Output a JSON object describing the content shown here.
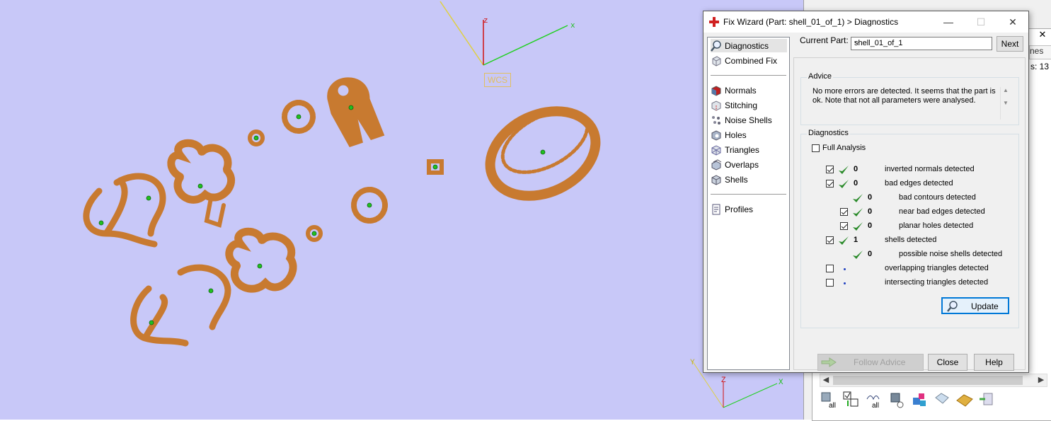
{
  "viewport": {
    "wcs_label": "WCS",
    "axis_labels": {
      "z": "z",
      "x": "x",
      "mini_z": "Z",
      "mini_x": "X",
      "mini_y": "Y"
    },
    "background_color": "#c8c8f8",
    "part_color": "#c87a30"
  },
  "right_panel": {
    "tab_label": "nes",
    "count_text": "s: 13",
    "close_glyph": "✕"
  },
  "dialog": {
    "title": "Fix Wizard (Part: shell_01_of_1) > Diagnostics",
    "window_buttons": {
      "minimize": "—",
      "maximize": "☐",
      "close": "✕"
    },
    "nav": {
      "top_items": [
        {
          "label": "Diagnostics",
          "icon": "magnifier-icon",
          "selected": true
        },
        {
          "label": "Combined Fix",
          "icon": "cube-icon"
        }
      ],
      "fix_items": [
        {
          "label": "Normals",
          "icon": "normals-icon"
        },
        {
          "label": "Stitching",
          "icon": "stitching-icon"
        },
        {
          "label": "Noise Shells",
          "icon": "noise-shells-icon"
        },
        {
          "label": "Holes",
          "icon": "holes-icon"
        },
        {
          "label": "Triangles",
          "icon": "triangles-icon"
        },
        {
          "label": "Overlaps",
          "icon": "overlaps-icon"
        },
        {
          "label": "Shells",
          "icon": "shells-icon"
        }
      ],
      "bottom_items": [
        {
          "label": "Profiles",
          "icon": "profiles-icon"
        }
      ]
    },
    "current_part_label": "Current Part:",
    "current_part_value": "shell_01_of_1",
    "next_button": "Next",
    "advice": {
      "title": "Advice",
      "text": "No more errors are detected. It seems that the part is ok. Note that not all parameters were analysed."
    },
    "diagnostics": {
      "title": "Diagnostics",
      "full_analysis_label": "Full Analysis",
      "full_analysis_checked": false,
      "rows": [
        {
          "checked": true,
          "has_checkbox": true,
          "status": "ok",
          "count": "0",
          "label": "inverted normals detected",
          "indent": 0
        },
        {
          "checked": true,
          "has_checkbox": true,
          "status": "ok",
          "count": "0",
          "label": "bad edges detected",
          "indent": 0
        },
        {
          "checked": false,
          "has_checkbox": false,
          "status": "ok",
          "count": "0",
          "label": "bad contours detected",
          "indent": 1
        },
        {
          "checked": true,
          "has_checkbox": true,
          "status": "ok",
          "count": "0",
          "label": "near bad edges detected",
          "indent": 1
        },
        {
          "checked": true,
          "has_checkbox": true,
          "status": "ok",
          "count": "0",
          "label": "planar holes detected",
          "indent": 1
        },
        {
          "checked": true,
          "has_checkbox": true,
          "status": "ok",
          "count": "1",
          "label": "shells detected",
          "indent": 0
        },
        {
          "checked": false,
          "has_checkbox": false,
          "status": "ok",
          "count": "0",
          "label": "possible noise shells detected",
          "indent": 1
        },
        {
          "checked": false,
          "has_checkbox": true,
          "status": "pending",
          "count": "",
          "label": "overlapping triangles detected",
          "indent": 0
        },
        {
          "checked": false,
          "has_checkbox": true,
          "status": "pending",
          "count": "",
          "label": "intersecting triangles detected",
          "indent": 0
        }
      ],
      "update_button": "Update"
    },
    "follow_advice_button": "Follow Advice",
    "close_button": "Close",
    "help_button": "Help"
  },
  "toolbar_bottom": {
    "items": [
      {
        "icon": "select-all-parts-icon",
        "label": "all"
      },
      {
        "icon": "toggle-selection-icon",
        "label": ""
      },
      {
        "icon": "select-all-shells-icon",
        "label": "all"
      },
      {
        "icon": "shell-select-icon",
        "label": ""
      },
      {
        "icon": "colorize-icon",
        "label": ""
      },
      {
        "icon": "part-view-icon",
        "label": ""
      },
      {
        "icon": "surface-icon",
        "label": ""
      },
      {
        "icon": "export-icon",
        "label": ""
      }
    ]
  }
}
